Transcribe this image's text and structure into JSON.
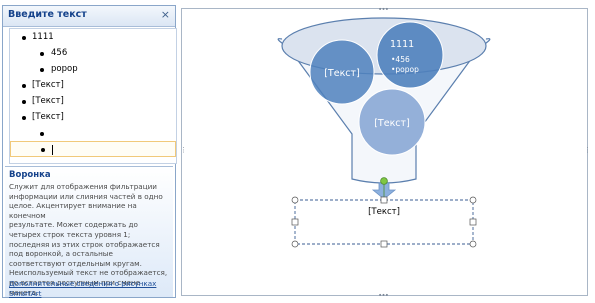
{
  "pane": {
    "title": "Введите текст",
    "close_glyph": "×",
    "items": [
      {
        "level": 1,
        "text": "1111"
      },
      {
        "level": 2,
        "text": "456"
      },
      {
        "level": 2,
        "text": "ророр"
      },
      {
        "level": 1,
        "text": "[Текст]"
      },
      {
        "level": 1,
        "text": "[Текст]"
      },
      {
        "level": 1,
        "text": "[Текст]"
      },
      {
        "level": 2,
        "text": ""
      },
      {
        "level": 2,
        "text": "",
        "editing": true
      }
    ]
  },
  "info": {
    "title": "Воронка",
    "lines": [
      "Служит для отображения фильтрации",
      "информации или слияния частей в одно",
      "целое. Акцентирует внимание на конечном",
      "результате. Может содержать до",
      "четырех строк текста уровня 1;",
      "последняя из этих строк отображается",
      "под воронкой, а остальные",
      "соответствуют отдельным кругам.",
      "Неиспользуемый текст не отображается,",
      "но остается доступным при смене макета."
    ],
    "link_lines": [
      "Дополнительные сведения о рисунках",
      "SmartArt"
    ]
  },
  "diagram": {
    "circle_left": "[Текст]",
    "circle_right_title": "1111",
    "circle_right_items": [
      "•456",
      "•ророр"
    ],
    "circle_bottom": "[Текст]",
    "result_box": "[Текст]",
    "colors": {
      "circle_dark": "#4f81bd",
      "circle_light": "#94b0d9",
      "funnel_fill": "#dbe3ef",
      "arrow": "#8cb0de",
      "rotate_handle": "#7fc742"
    }
  },
  "icons": {
    "close": "close-icon",
    "edge_handle": "drag-handle-icon"
  }
}
